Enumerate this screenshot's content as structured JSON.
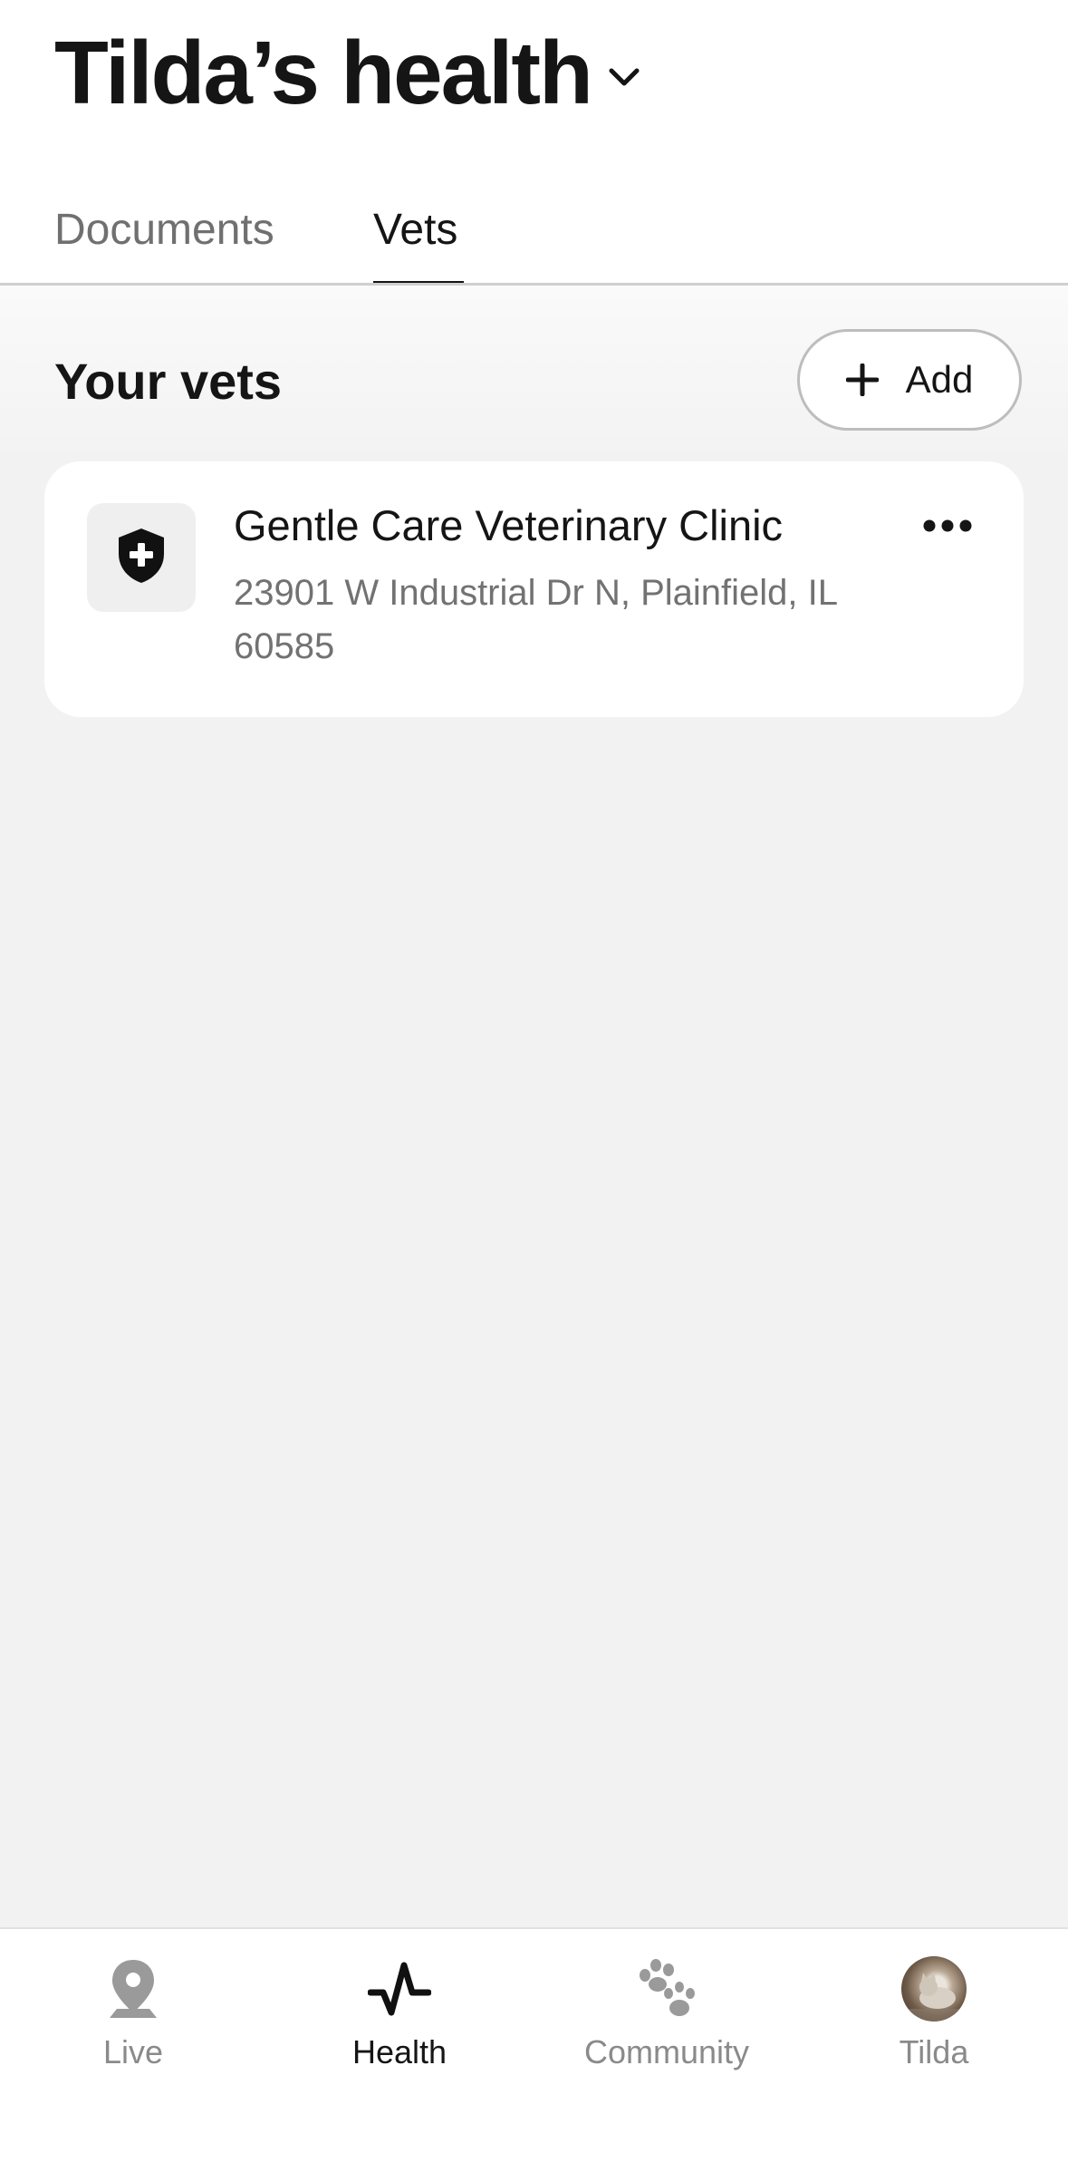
{
  "header": {
    "title": "Tilda’s health"
  },
  "tabs": [
    {
      "label": "Documents",
      "active": false
    },
    {
      "label": "Vets",
      "active": true
    }
  ],
  "section": {
    "title": "Your vets",
    "add_label": "Add"
  },
  "vets": [
    {
      "name": "Gentle Care Veterinary Clinic",
      "address": "23901 W Industrial Dr N, Plainfield, IL 60585",
      "icon": "shield-plus-icon"
    }
  ],
  "nav": {
    "items": [
      {
        "label": "Live",
        "icon": "location-pin-icon",
        "active": false
      },
      {
        "label": "Health",
        "icon": "heartbeat-icon",
        "active": true
      },
      {
        "label": "Community",
        "icon": "paw-icon",
        "active": false
      },
      {
        "label": "Tilda",
        "icon": "avatar",
        "active": false
      }
    ]
  },
  "colors": {
    "background": "#f2f2f2",
    "surface": "#ffffff",
    "text": "#151515",
    "muted": "#707070",
    "inactive_icon": "#9a9a9a"
  }
}
